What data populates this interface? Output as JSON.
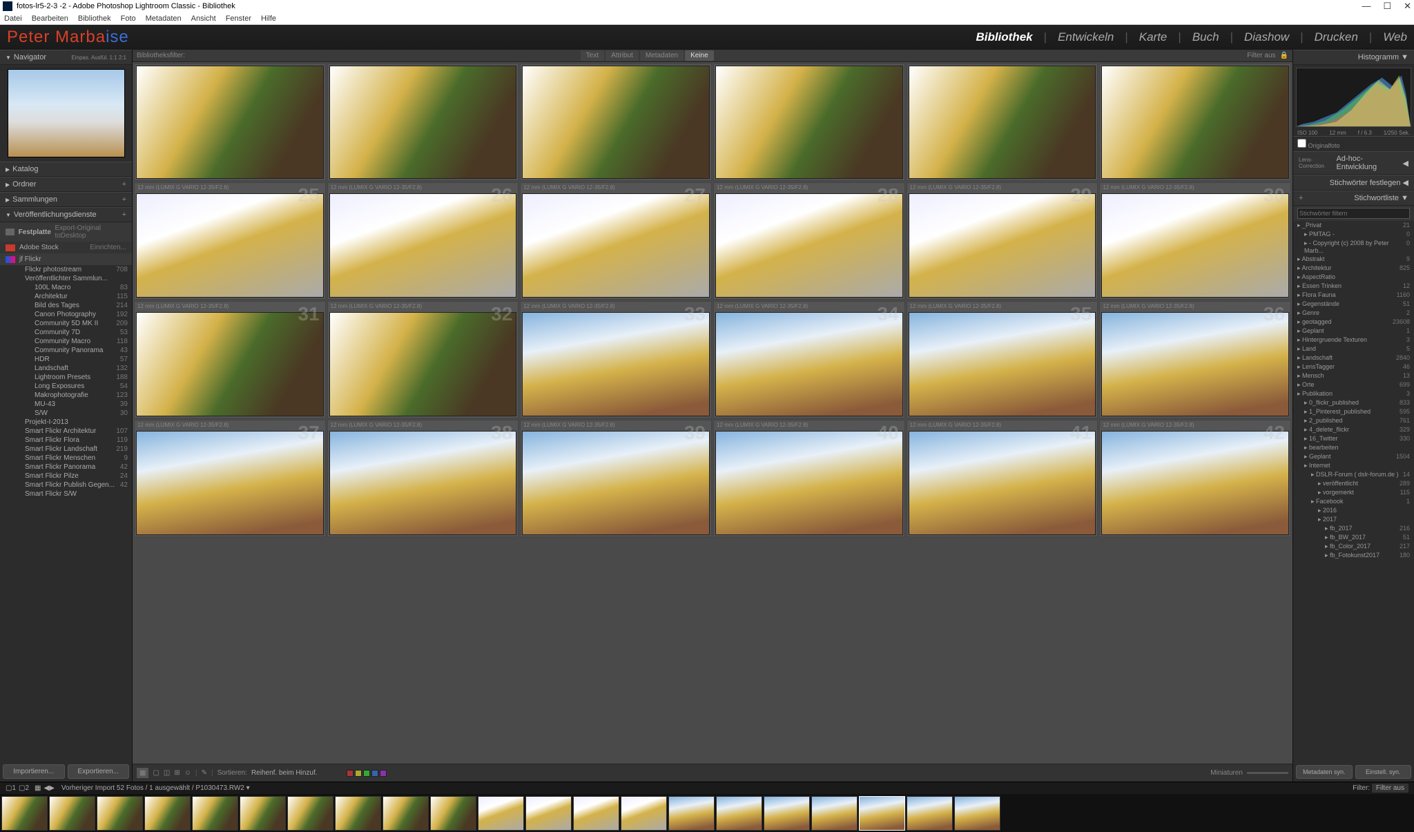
{
  "window": {
    "title": "fotos-lr5-2-3 -2 - Adobe Photoshop Lightroom Classic - Bibliothek"
  },
  "menu": [
    "Datei",
    "Bearbeiten",
    "Bibliothek",
    "Foto",
    "Metadaten",
    "Ansicht",
    "Fenster",
    "Hilfe"
  ],
  "brand": {
    "first": "Peter Marba",
    "tail": "ise"
  },
  "modules": [
    {
      "label": "Bibliothek",
      "active": true
    },
    {
      "label": "Entwickeln"
    },
    {
      "label": "Karte"
    },
    {
      "label": "Buch"
    },
    {
      "label": "Diashow"
    },
    {
      "label": "Drucken"
    },
    {
      "label": "Web"
    }
  ],
  "nav": {
    "title": "Navigator",
    "opts": "Einpas.  Ausfül.  1:1  2:1"
  },
  "leftpanels": {
    "katalog": "Katalog",
    "ordner": "Ordner",
    "sammlungen": "Sammlungen",
    "publish": "Veröffentlichungsdienste",
    "festplatte": "Festplatte",
    "export": "Export-Original toDesktop",
    "adobe": "Adobe Stock",
    "einrichten": "Einrichten...",
    "flickr": "jf Flickr"
  },
  "flickr_tree": [
    {
      "label": "Flickr photostream",
      "count": "708"
    },
    {
      "label": "Veröffentlichter Sammlun...",
      "count": ""
    },
    {
      "label": "100L Macro",
      "count": "83",
      "ind": 2
    },
    {
      "label": "Architektur",
      "count": "115",
      "ind": 2
    },
    {
      "label": "Bild des Tages",
      "count": "214",
      "ind": 2
    },
    {
      "label": "Canon Photography",
      "count": "192",
      "ind": 2
    },
    {
      "label": "Community 5D MK II",
      "count": "209",
      "ind": 2
    },
    {
      "label": "Community 7D",
      "count": "53",
      "ind": 2
    },
    {
      "label": "Community Macro",
      "count": "118",
      "ind": 2
    },
    {
      "label": "Community Panorama",
      "count": "43",
      "ind": 2
    },
    {
      "label": "HDR",
      "count": "57",
      "ind": 2
    },
    {
      "label": "Landschaft",
      "count": "132",
      "ind": 2
    },
    {
      "label": "Lightroom Presets",
      "count": "188",
      "ind": 2
    },
    {
      "label": "Long Exposures",
      "count": "54",
      "ind": 2
    },
    {
      "label": "Makrophotografie",
      "count": "123",
      "ind": 2
    },
    {
      "label": "MU-43",
      "count": "39",
      "ind": 2
    },
    {
      "label": "S/W",
      "count": "30",
      "ind": 2
    },
    {
      "label": "Projekt-I-2013",
      "count": ""
    },
    {
      "label": "Smart Flickr Architektur",
      "count": "107"
    },
    {
      "label": "Smart Flickr Flora",
      "count": "119"
    },
    {
      "label": "Smart Flickr Landschaft",
      "count": "219"
    },
    {
      "label": "Smart Flickr Menschen",
      "count": "9"
    },
    {
      "label": "Smart Flickr Panorama",
      "count": "42"
    },
    {
      "label": "Smart Flickr Pilze",
      "count": "24"
    },
    {
      "label": "Smart Flickr Publish Gegen...",
      "count": "42"
    },
    {
      "label": "Smart Flickr S/W",
      "count": ""
    }
  ],
  "leftbtns": {
    "import": "Importieren...",
    "export": "Exportieren..."
  },
  "filterbar": {
    "label": "Bibliotheksfilter:",
    "tabs": [
      "Text",
      "Attribut",
      "Metadaten",
      "Keine"
    ],
    "right": "Filter aus"
  },
  "cell_meta": "12 mm (LUMIX G VARIO 12-35/F2.8)",
  "grid_numbers": [
    null,
    null,
    null,
    null,
    null,
    null,
    25,
    26,
    27,
    28,
    29,
    30,
    31,
    32,
    33,
    34,
    35,
    36,
    37,
    38,
    39,
    40,
    41,
    42
  ],
  "grid_thumb_types": [
    "t1",
    "t1",
    "t1",
    "t1",
    "t1",
    "t1",
    "t2",
    "t2",
    "t2",
    "t2",
    "t2",
    "t2",
    "t1",
    "t1",
    "t3",
    "t3",
    "t3",
    "t3",
    "t3",
    "t3",
    "t3",
    "t3",
    "t3",
    "t3"
  ],
  "toolbar": {
    "sort_label": "Sortieren:",
    "sort_value": "Reihenf. beim Hinzuf.",
    "thumbs": "Miniaturen"
  },
  "right": {
    "histogram": "Histogramm",
    "stats": {
      "iso": "ISO 100",
      "focal": "12 mm",
      "ap": "f / 6.3",
      "shutter": "1/250 Sek."
    },
    "original": "Originalfoto",
    "lens": "Lens-Correction",
    "adhoc": "Ad-hoc-Entwicklung",
    "kw_set": "Stichwörter festlegen",
    "kw_list": "Stichwortliste",
    "kw_filter": "Stichwörter filtern"
  },
  "keywords": [
    {
      "label": "_Privat",
      "count": "21"
    },
    {
      "label": "PMTAG -",
      "count": "0",
      "ind": 1
    },
    {
      "label": "- Copyright (c) 2008 by Peter Marb...",
      "count": "0",
      "ind": 1
    },
    {
      "label": "Abstrakt",
      "count": "9"
    },
    {
      "label": "Architektur",
      "count": "825"
    },
    {
      "label": "AspectRatio",
      "count": ""
    },
    {
      "label": "Essen Trinken",
      "count": "12"
    },
    {
      "label": "Flora Fauna",
      "count": "1160"
    },
    {
      "label": "Gegenstände",
      "count": "51"
    },
    {
      "label": "Genre",
      "count": "2"
    },
    {
      "label": "geotagged",
      "count": "23608"
    },
    {
      "label": "Geplant",
      "count": "1"
    },
    {
      "label": "Hintergruende Texturen",
      "count": "3"
    },
    {
      "label": "Land",
      "count": "5"
    },
    {
      "label": "Landschaft",
      "count": "2840"
    },
    {
      "label": "LensTagger",
      "count": "46"
    },
    {
      "label": "Mensch",
      "count": "13"
    },
    {
      "label": "Orte",
      "count": "699"
    },
    {
      "label": "Publikation",
      "count": "3"
    },
    {
      "label": "0_flickr_published",
      "count": "833",
      "ind": 1
    },
    {
      "label": "1_Pinterest_published",
      "count": "595",
      "ind": 1
    },
    {
      "label": "2_published",
      "count": "761",
      "ind": 1
    },
    {
      "label": "4_delete_flickr",
      "count": "329",
      "ind": 1
    },
    {
      "label": "16_Twitter",
      "count": "330",
      "ind": 1
    },
    {
      "label": "bearbeiten",
      "count": "",
      "ind": 1
    },
    {
      "label": "Geplant",
      "count": "1504",
      "ind": 1
    },
    {
      "label": "Internet",
      "count": "",
      "ind": 1
    },
    {
      "label": "DSLR-Forum ( dslr-forum.de )",
      "count": "14",
      "ind": 2
    },
    {
      "label": "veröffentlicht",
      "count": "289",
      "ind": 3
    },
    {
      "label": "vorgemerkt",
      "count": "115",
      "ind": 3
    },
    {
      "label": "Facebook",
      "count": "1",
      "ind": 2
    },
    {
      "label": "2016",
      "count": "",
      "ind": 3
    },
    {
      "label": "2017",
      "count": "",
      "ind": 3
    },
    {
      "label": "fb_2017",
      "count": "216",
      "ind": 4
    },
    {
      "label": "fb_BW_2017",
      "count": "51",
      "ind": 4
    },
    {
      "label": "fb_Color_2017",
      "count": "217",
      "ind": 4
    },
    {
      "label": "fb_Fotokunst2017",
      "count": "180",
      "ind": 4
    }
  ],
  "rightbtns": {
    "sync": "Metadaten syn.",
    "apply": "Einstell. syn."
  },
  "infobar": {
    "left": "Vorheriger Import   52 Fotos / 1 ausgewählt / P1030473.RW2 ▾",
    "filter": "Filter:",
    "filteroff": "Filter aus"
  },
  "filmstrip_count": 21,
  "filmstrip_selected": 18
}
